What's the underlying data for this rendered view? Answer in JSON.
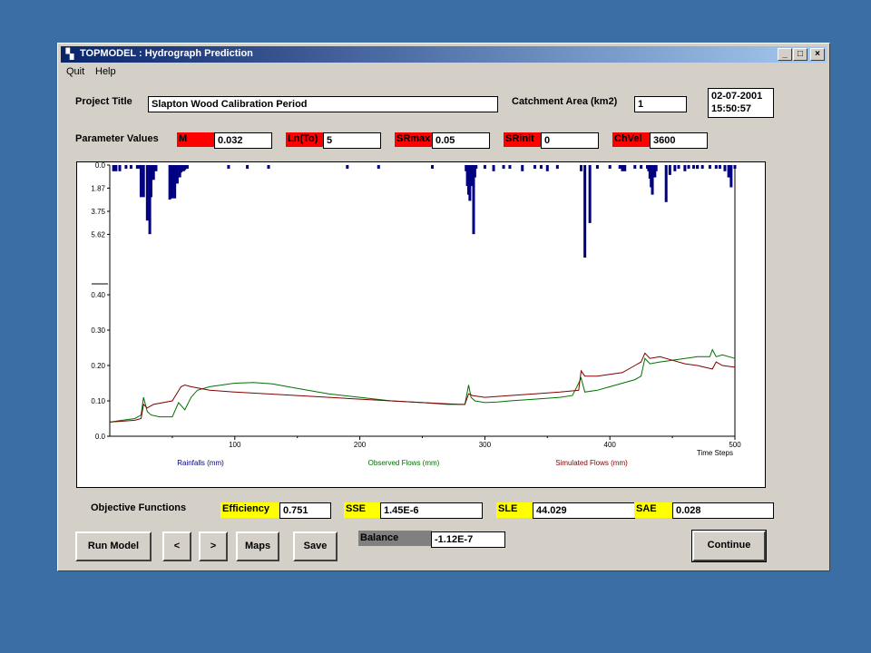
{
  "window": {
    "title": "TOPMODEL : Hydrograph Prediction",
    "min": "_",
    "max": "□",
    "close": "×"
  },
  "menu": [
    "Quit",
    "Help"
  ],
  "project": {
    "title_label": "Project Title",
    "title_value": "Slapton Wood Calibration Period",
    "area_label": "Catchment Area (km2)",
    "area_value": "1",
    "date": "02-07-2001",
    "time": "15:50:57"
  },
  "parameters": {
    "label": "Parameter Values",
    "items": [
      {
        "name": "M",
        "value": "0.032"
      },
      {
        "name": "Ln(To)",
        "value": "5"
      },
      {
        "name": "SRmax",
        "value": "0.05"
      },
      {
        "name": "SRinit",
        "value": "0"
      },
      {
        "name": "ChVel",
        "value": "3600"
      }
    ]
  },
  "colors": {
    "param_bg": "#ff0000",
    "objective_bg": "#ffff00",
    "rain": "#000080",
    "observed": "#007000",
    "simulated": "#800000"
  },
  "chart_data": {
    "type": "line",
    "xlabel": "Time Steps",
    "xlim": [
      0,
      500
    ],
    "x_ticks": [
      "100",
      "200",
      "300",
      "400",
      "500"
    ],
    "rain_ticks": [
      "0.0",
      "1.87",
      "3.75",
      "5.62"
    ],
    "flow_ticks": [
      "0.40",
      "0.30",
      "0.20",
      "0.10",
      "0.0"
    ],
    "rain_ylim": [
      0,
      7.5
    ],
    "flow_ylim": [
      0,
      0.4
    ],
    "legend": [
      "Rainfalls (mm)",
      "Observed Flows (mm)",
      "Simulated Flows (mm)"
    ],
    "rainfall": {
      "x": [
        3,
        5,
        8,
        13,
        17,
        22,
        24,
        25,
        27,
        30,
        32,
        33,
        35,
        37,
        48,
        50,
        51,
        52,
        54,
        56,
        57,
        59,
        60,
        62,
        95,
        110,
        127,
        190,
        215,
        258,
        285,
        286,
        287,
        288,
        289,
        290,
        291,
        292,
        293,
        300,
        307,
        315,
        330,
        340,
        350,
        358,
        377,
        390,
        400,
        408,
        410,
        412,
        430,
        437,
        470,
        474,
        470,
        480,
        485,
        488,
        492,
        495,
        497,
        500,
        320,
        345,
        380,
        384,
        420,
        425,
        431,
        432,
        433,
        434,
        436,
        445,
        448,
        452,
        455,
        460,
        463,
        467
      ],
      "y": [
        0.5,
        0.5,
        0.5,
        0.3,
        0.3,
        0.3,
        0.3,
        2.6,
        2.6,
        4.5,
        5.6,
        2.6,
        1.2,
        0.5,
        2.8,
        2.7,
        2.0,
        2.7,
        1.5,
        1.0,
        0.6,
        0.5,
        0.4,
        0.3,
        0.3,
        0.3,
        0.3,
        0.3,
        0.3,
        0.3,
        0.5,
        1.7,
        2.4,
        2.9,
        1.7,
        0.7,
        5.6,
        1.0,
        0.3,
        0.3,
        0.5,
        0.3,
        0.5,
        0.3,
        0.5,
        0.3,
        0.5,
        0.3,
        0.3,
        0.3,
        0.5,
        0.5,
        0.3,
        0.5,
        0.3,
        0.3,
        0.3,
        0.3,
        0.3,
        0.3,
        0.5,
        1.0,
        1.8,
        0.3,
        0.3,
        0.3,
        7.5,
        4.7,
        0.3,
        0.3,
        0.5,
        1.1,
        1.8,
        2.4,
        1.0,
        3.0,
        0.8,
        0.5,
        0.3,
        0.5,
        0.3,
        0.3
      ]
    },
    "series": [
      {
        "name": "Observed Flows (mm)",
        "x": [
          0,
          10,
          20,
          25,
          27,
          30,
          33,
          40,
          50,
          55,
          60,
          65,
          70,
          80,
          100,
          115,
          130,
          150,
          175,
          200,
          225,
          250,
          270,
          284,
          287,
          289,
          292,
          300,
          310,
          320,
          340,
          360,
          370,
          375,
          377,
          380,
          390,
          400,
          410,
          420,
          425,
          428,
          432,
          440,
          450,
          460,
          470,
          480,
          482,
          485,
          490,
          500
        ],
        "y": [
          0.04,
          0.045,
          0.05,
          0.06,
          0.11,
          0.07,
          0.06,
          0.055,
          0.055,
          0.095,
          0.075,
          0.11,
          0.13,
          0.14,
          0.15,
          0.152,
          0.148,
          0.135,
          0.12,
          0.11,
          0.1,
          0.095,
          0.09,
          0.09,
          0.145,
          0.11,
          0.1,
          0.095,
          0.097,
          0.1,
          0.105,
          0.11,
          0.115,
          0.15,
          0.165,
          0.125,
          0.13,
          0.14,
          0.15,
          0.16,
          0.17,
          0.22,
          0.205,
          0.21,
          0.215,
          0.22,
          0.225,
          0.225,
          0.245,
          0.225,
          0.23,
          0.22
        ]
      },
      {
        "name": "Simulated Flows (mm)",
        "x": [
          0,
          20,
          25,
          27,
          30,
          35,
          50,
          57,
          60,
          65,
          80,
          100,
          150,
          200,
          250,
          280,
          284,
          287,
          290,
          300,
          320,
          340,
          360,
          375,
          377,
          380,
          390,
          400,
          410,
          420,
          425,
          428,
          432,
          440,
          450,
          460,
          470,
          482,
          485,
          490,
          500
        ],
        "y": [
          0.04,
          0.045,
          0.05,
          0.09,
          0.08,
          0.09,
          0.1,
          0.14,
          0.145,
          0.14,
          0.13,
          0.125,
          0.115,
          0.105,
          0.095,
          0.09,
          0.09,
          0.12,
          0.115,
          0.11,
          0.115,
          0.12,
          0.125,
          0.13,
          0.185,
          0.17,
          0.17,
          0.175,
          0.18,
          0.2,
          0.21,
          0.235,
          0.22,
          0.225,
          0.215,
          0.205,
          0.2,
          0.19,
          0.21,
          0.2,
          0.195
        ]
      }
    ]
  },
  "objectives": {
    "label": "Objective Functions",
    "items": [
      {
        "name": "Efficiency",
        "value": "0.751"
      },
      {
        "name": "SSE",
        "value": "1.45E-6"
      },
      {
        "name": "SLE",
        "value": "44.029"
      },
      {
        "name": "SAE",
        "value": "0.028"
      }
    ],
    "balance_label": "Balance",
    "balance_value": "-1.12E-7"
  },
  "buttons": {
    "run": "Run Model",
    "prev": "<",
    "next": ">",
    "maps": "Maps",
    "save": "Save",
    "continue": "Continue"
  }
}
